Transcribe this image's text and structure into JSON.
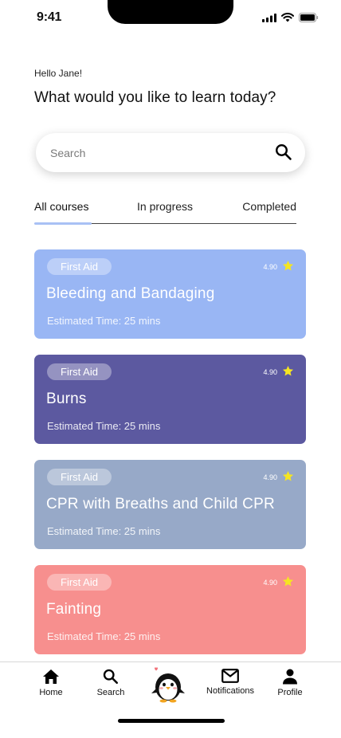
{
  "status": {
    "time": "9:41"
  },
  "greeting": "Hello Jane!",
  "headline": "What would you like to learn today?",
  "search": {
    "placeholder": "Search"
  },
  "tabs": [
    {
      "label": "All courses",
      "active": true
    },
    {
      "label": "In progress",
      "active": false
    },
    {
      "label": "Completed",
      "active": false
    }
  ],
  "courses": [
    {
      "category": "First Aid",
      "rating": "4.90",
      "title": "Bleeding and Bandaging",
      "time": "Estimated Time: 25 mins",
      "color": "#99b6f4"
    },
    {
      "category": "First Aid",
      "rating": "4.90",
      "title": "Burns",
      "time": "Estimated Time: 25 mins",
      "color": "#5c59a0"
    },
    {
      "category": "First Aid",
      "rating": "4.90",
      "title": "CPR with Breaths and Child CPR",
      "time": "Estimated Time: 25 mins",
      "color": "#97a9c8"
    },
    {
      "category": "First Aid",
      "rating": "4.90",
      "title": "Fainting",
      "time": "Estimated Time: 25 mins",
      "color": "#f78f8e"
    }
  ],
  "nav": {
    "home": "Home",
    "search": "Search",
    "notifications": "Notifications",
    "profile": "Profile"
  },
  "colors": {
    "star": "#f5e522",
    "tab_indicator": "#a9c1f5"
  },
  "icons": [
    "signal-icon",
    "wifi-icon",
    "battery-icon",
    "search-icon",
    "star-icon",
    "home-icon",
    "mail-icon",
    "person-icon",
    "penguin-mascot-icon"
  ]
}
